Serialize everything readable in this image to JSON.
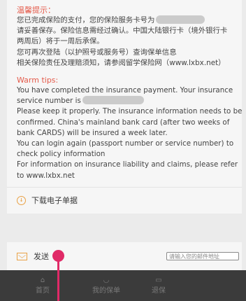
{
  "tips": {
    "cn_title": "温馨提示：",
    "cn_lines": [
      "您已完成保险的支付，您的保险服务卡号为",
      "请妥善保存。保险信息需经过确认。中国大陆银行卡（境外银行卡",
      "两周后）将于一周后承保。",
      "您可再次登陆（以护照号或服务号）查询保单信息",
      "相关保险责任及理赔须知，请参阅留学保险网（www.lxbx.net）"
    ],
    "en_title": "Warm tips:",
    "en_lines": [
      "You have completed the insurance payment. Your insurance",
      "service number is",
      "Please keep it properly. The insurance information needs to be",
      "confirmed. China's mainland bank card (after two weeks of",
      "bank CARDS) will be insured a week later.",
      "You can login again (passport number or service number) to",
      "check policy information",
      "For information on insurance liability and claims, please refer",
      "to www.lxbx.net"
    ]
  },
  "download": {
    "label": "下载电子单据",
    "icon": "download-circle-icon"
  },
  "send": {
    "label": "发送",
    "icon": "mail-icon",
    "email_placeholder": "请输入您的邮件地址",
    "email_value": ""
  },
  "tabbar": {
    "items": [
      {
        "label": "首页",
        "icon": "home-icon"
      },
      {
        "label": "我的保单",
        "icon": "shield-icon"
      },
      {
        "label": "退保",
        "icon": "document-icon"
      }
    ]
  },
  "colors": {
    "accent": "#e45a4a",
    "icon_orange": "#e9a145",
    "tabbar_bg": "#3b3b3b",
    "cursor": "#e02a67"
  }
}
